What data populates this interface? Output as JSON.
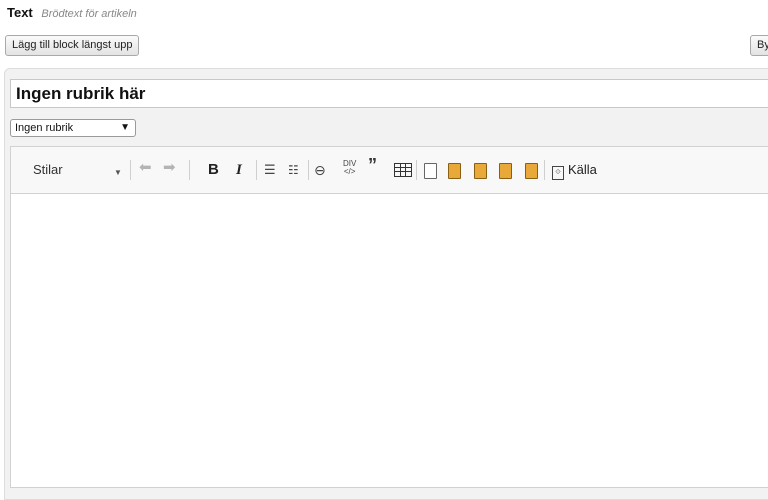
{
  "section": {
    "title": "Text",
    "subtitle": "Brödtext för artikeln"
  },
  "buttons": {
    "add_block_top": "Lägg till block längst upp",
    "swap_partial": "By"
  },
  "heading_field": {
    "value": "Ingen rubrik här"
  },
  "heading_select": {
    "selected": "Ingen rubrik"
  },
  "toolbar": {
    "styles_label": "Stilar",
    "bold_glyph": "B",
    "italic_glyph": "I",
    "div_glyph": "DIV",
    "source_label": "Källa",
    "icons": [
      "undo-icon",
      "redo-icon",
      "bold-icon",
      "italic-icon",
      "bulleted-list-icon",
      "numbered-list-icon",
      "link-icon",
      "div-container-icon",
      "blockquote-icon",
      "table-icon",
      "paste-icon",
      "paste-as-text-icon",
      "paste-from-word-icon",
      "paste-image-icon",
      "paste-template-icon",
      "source-icon"
    ]
  },
  "colors": {
    "panel_bg": "#f2f2f2",
    "toolbar_bg": "#f8f8f8",
    "paste_icon_orange": "#e8a83a"
  }
}
